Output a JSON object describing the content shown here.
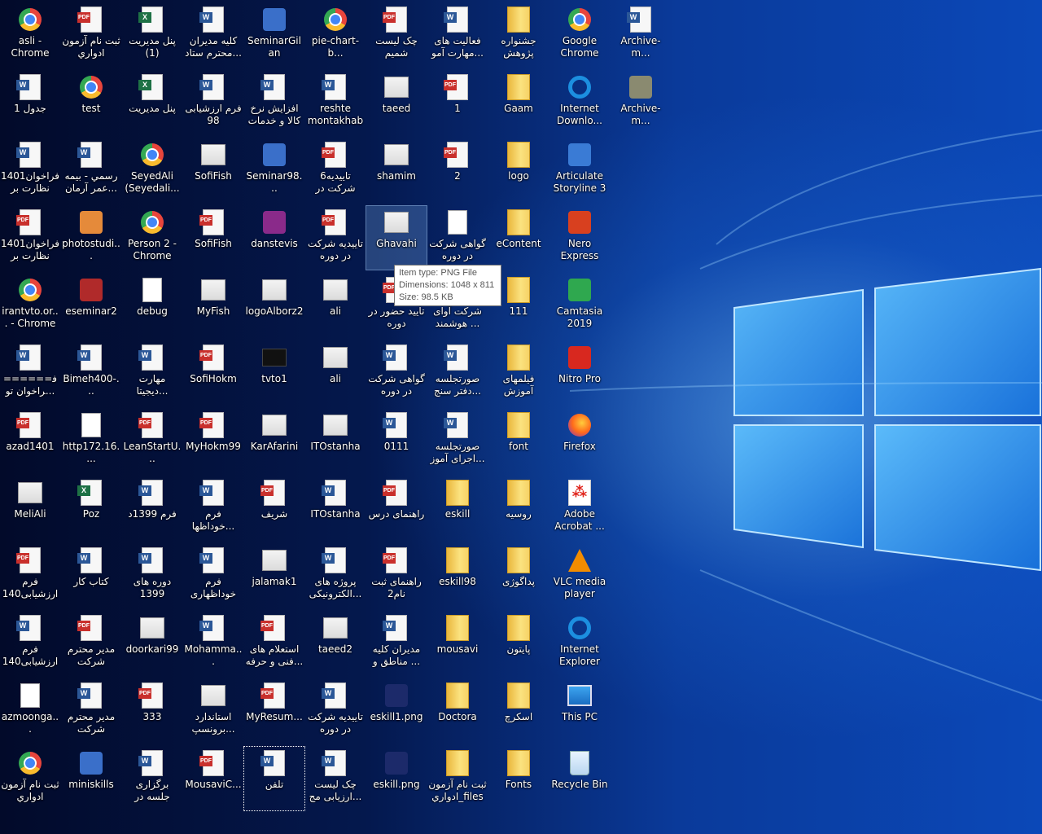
{
  "desktop": {
    "columns": [
      [
        "asli - Chrome",
        "جدول 1",
        "1401فراخوان نظارت بر تو...",
        "1401فراخوان نظارت بر تو...",
        "irantvto.or... - Chrome",
        "======فراخوان تو...",
        "azad1401",
        "MeliAli",
        "فرم ارزشیابی1400",
        "فرم ارزشیابی1400",
        "azmoonga...",
        "ثبت نام آزمون ادواري"
      ],
      [
        "ثبت نام آزمون ادواري",
        "test",
        "رسمي - بيمه عمر آرمان...",
        "photostudi...",
        "eseminar2",
        "Bimeh400-...",
        "http172.16....",
        "Poz",
        "كتاب كار",
        "مدير محترم شركت پرداخ...",
        "مدير محترم شركت پرداخ...",
        "miniskills"
      ],
      [
        "پنل مدیریت (1)",
        "پنل مدیریت",
        "SeyedAli (Seyedali...",
        "Person 2 - Chrome",
        "debug",
        "مهارت دیجیتا...",
        "LeanStartU...",
        "فرم 1399د",
        "دوره های 1399",
        "doorkari99",
        "333",
        "برگزاری جلسه در خصوص..."
      ],
      [
        "کلیه مدیران محترم ستاد...",
        "فرم ارزشیابی 98",
        "SofiFish",
        "SofiFish",
        "MyFish",
        "SofiHokm",
        "MyHokm99",
        "فرم خوداظها...",
        "فرم خوداظهاری",
        "Mohamma...",
        "استاندارد برونسپ...",
        "MousaviC..."
      ],
      [
        "SeminarGilan",
        "افزایش نرخ کالا و خدمات",
        "Seminar98...",
        "danstevis",
        "logoAlborz2",
        "tvto1",
        "KarAfarini",
        "شریف",
        "jalamak1",
        "استعلام های فنی و حرفه...",
        "MyResum...",
        "تلفن"
      ],
      [
        "pie-chart-b...",
        "reshte montakhab",
        "6تاییدیه شرکت در دوره مهار...",
        "تاییدیه شرکت در دوره مهار...",
        "ali",
        "ali",
        "ITOstanha",
        "ITOstanha",
        "پروژه های الکترونیکی...",
        "taeed2",
        "تاییدیه شرکت در دوره مهار...",
        "چک لیست ارزیابی مج..."
      ],
      [
        "چک لیست شمیم",
        "taeed",
        "shamim",
        "Ghavahi",
        "تایید حضور در دوره",
        "گواهی شرکت در دوره مهار...",
        "0111",
        "راهنمای درس",
        "راهنمای ثبت نام2",
        "مدیران کلیه مناطق و ...",
        "eskill1.png",
        "eskill.png"
      ],
      [
        "فعالیت های مهارت آمو...",
        "1",
        "2",
        "گواهی شرکت در دوره مهار...",
        "شرکت آوای هوشمند ...",
        "صورتجلسه دفتر سنج...",
        "صورتجلسه اجرای آموز...",
        "eskill",
        "eskill98",
        "mousavi",
        "Doctora",
        "ثبت نام آزمون ادواري_files"
      ],
      [
        "جشنواره پژوهش",
        "Gaam",
        "logo",
        "eContent",
        "111",
        "فیلمهای آموزش",
        "font",
        "روسیه",
        "پداگوژی",
        "پایتون",
        "اسکرچ",
        "Fonts"
      ],
      [
        "Google Chrome",
        "Internet Downlo...",
        "Articulate Storyline 3",
        "Nero Express",
        "Camtasia 2019",
        "Nitro Pro",
        "Firefox",
        "Adobe Acrobat ...",
        "VLC media player",
        "Internet Explorer",
        "This PC",
        "Recycle Bin"
      ],
      [
        "Archive-m...",
        "Archive-m..."
      ]
    ],
    "types": [
      [
        "chrome",
        "word",
        "word",
        "pdf",
        "chrome",
        "word",
        "pdf",
        "img",
        "pdf",
        "word",
        "txt",
        "chrome"
      ],
      [
        "pdf",
        "chrome",
        "word",
        "app-orange",
        "app-red",
        "word",
        "txt",
        "excel",
        "word",
        "pdf",
        "word",
        "app-blue"
      ],
      [
        "excel",
        "excel",
        "chrome",
        "chrome",
        "txt",
        "word",
        "pdf",
        "word",
        "word",
        "img",
        "pdf",
        "word"
      ],
      [
        "word",
        "word",
        "img",
        "pdf",
        "img",
        "pdf",
        "pdf",
        "word",
        "word",
        "word",
        "img",
        "pdf"
      ],
      [
        "app-blue",
        "word",
        "app-blue",
        "app-rar",
        "img",
        "dark",
        "img",
        "pdf",
        "img",
        "pdf",
        "pdf",
        "word"
      ],
      [
        "chrome",
        "word",
        "pdf",
        "pdf",
        "img",
        "img",
        "img",
        "word",
        "word",
        "img",
        "word",
        "word"
      ],
      [
        "pdf",
        "img",
        "img",
        "img",
        "pdf",
        "word",
        "word",
        "pdf",
        "pdf",
        "word",
        "app-navy",
        "app-navy"
      ],
      [
        "word",
        "pdf",
        "pdf",
        "txt",
        "pdf",
        "word",
        "word",
        "folder",
        "folder",
        "folder",
        "folder",
        "folder"
      ],
      [
        "folder",
        "folder",
        "folder",
        "folder",
        "folder",
        "folder",
        "folder",
        "folder",
        "folder",
        "folder",
        "folder",
        "folder"
      ],
      [
        "chrome",
        "app-ie",
        "app-storyline",
        "app-nero",
        "app-camtasia",
        "app-nitro",
        "firefox",
        "acrobat",
        "vlc",
        "ie",
        "pc",
        "recycle"
      ],
      [
        "word",
        "app-gray"
      ]
    ],
    "selected_label": "Ghavahi",
    "focused_label": "تلفن"
  },
  "tooltip": {
    "line1": "Item type: PNG File",
    "line2": "Dimensions: 1048 x 811",
    "line3": "Size: 98.5 KB"
  }
}
